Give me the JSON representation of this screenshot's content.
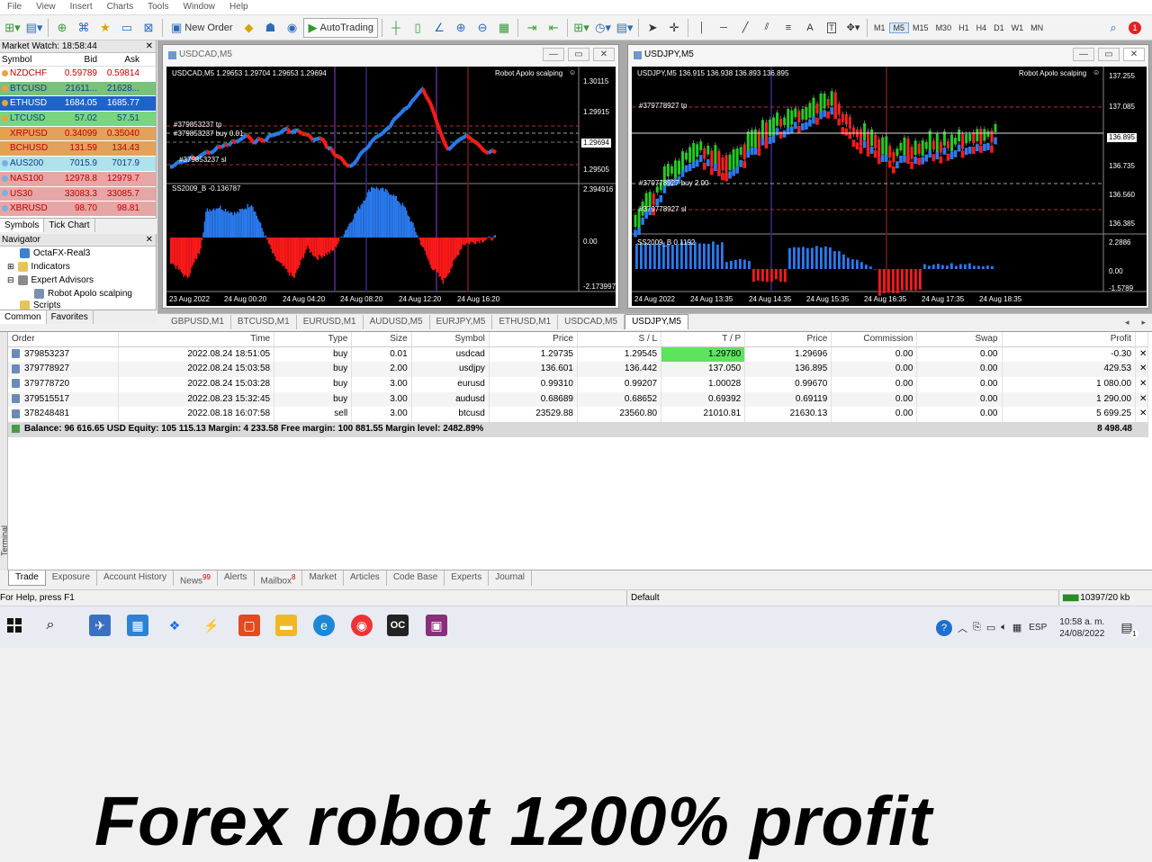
{
  "menubar": {
    "items": [
      "File",
      "View",
      "Insert",
      "Charts",
      "Tools",
      "Window",
      "Help"
    ]
  },
  "toolbar": {
    "new_order": "New Order",
    "autotrading": "AutoTrading",
    "timeframes": [
      "M1",
      "M5",
      "M15",
      "M30",
      "H1",
      "H4",
      "D1",
      "W1",
      "MN"
    ],
    "active_timeframe": "M5",
    "text_tool": "A",
    "label_tool": "T",
    "notification_count": "1"
  },
  "market_watch": {
    "title": "Market Watch: 18:58:44",
    "headers": [
      "Symbol",
      "Bid",
      "Ask"
    ],
    "rows": [
      {
        "symbol": "NZDCHF",
        "bid": "0.59789",
        "ask": "0.59814",
        "bg": "#ffffff",
        "fg": "#c00000",
        "dot": "#e8a33d"
      },
      {
        "symbol": "BTCUSD",
        "bid": "21611...",
        "ask": "21628...",
        "bg": "#79c279",
        "fg": "#0b3f8a",
        "dot": "#e8a33d"
      },
      {
        "symbol": "ETHUSD",
        "bid": "1684.05",
        "ask": "1685.77",
        "bg": "#1e64c8",
        "fg": "#ffffff",
        "dot": "#e8a33d"
      },
      {
        "symbol": "LTCUSD",
        "bid": "57.02",
        "ask": "57.51",
        "bg": "#78d67e",
        "fg": "#0b3f8a",
        "dot": "#e8a33d"
      },
      {
        "symbol": "XRPUSD",
        "bid": "0.34099",
        "ask": "0.35040",
        "bg": "#e2a25b",
        "fg": "#c00000",
        "dot": "#e8a33d"
      },
      {
        "symbol": "BCHUSD",
        "bid": "131.59",
        "ask": "134.43",
        "bg": "#e2a25b",
        "fg": "#c00000",
        "dot": "#e8a33d"
      },
      {
        "symbol": "AUS200",
        "bid": "7015.9",
        "ask": "7017.9",
        "bg": "#aee3ec",
        "fg": "#0b3f8a",
        "dot": "#7ab0e0"
      },
      {
        "symbol": "NAS100",
        "bid": "12978.8",
        "ask": "12979.7",
        "bg": "#e7a6a6",
        "fg": "#c00000",
        "dot": "#7ab0e0"
      },
      {
        "symbol": "US30",
        "bid": "33083.3",
        "ask": "33085.7",
        "bg": "#e7a6a6",
        "fg": "#c00000",
        "dot": "#7ab0e0"
      },
      {
        "symbol": "XBRUSD",
        "bid": "98.70",
        "ask": "98.81",
        "bg": "#e7a6a6",
        "fg": "#c00000",
        "dot": "#7ab0e0"
      }
    ],
    "tabs": [
      "Symbols",
      "Tick Chart"
    ]
  },
  "navigator": {
    "title": "Navigator",
    "items": [
      "OctaFX-Real3",
      "Indicators",
      "Expert Advisors",
      "Robot Apolo scalping",
      "Scripts"
    ],
    "tabs": [
      "Common",
      "Favorites"
    ]
  },
  "chart_usdcad": {
    "window_title": "USDCAD,M5",
    "header": "USDCAD,M5  1.29653 1.29704 1.29653 1.29694",
    "robot": "Robot Apolo scalping",
    "price_ticks": [
      "1.30115",
      "1.29915",
      "1.29694",
      "1.29505"
    ],
    "current_price": "1.29694",
    "order_labels": [
      "#379853237 tp",
      "#379853237 buy 0.01",
      "#379853237 sl"
    ],
    "indicator_label": "SS2009_B -0.136787",
    "indicator_ticks": [
      "2.394916",
      "0.00",
      "-2.173997"
    ],
    "time_ticks": [
      "23 Aug 2022",
      "24 Aug 00:20",
      "24 Aug 04:20",
      "24 Aug 08:20",
      "24 Aug 12:20",
      "24 Aug 16:20"
    ]
  },
  "chart_usdjpy": {
    "window_title": "USDJPY,M5",
    "header": "USDJPY,M5  136.915 136.938 136.893 136.895",
    "robot": "Robot Apolo scalping",
    "price_ticks": [
      "137.255",
      "137.085",
      "136.895",
      "136.735",
      "136.560",
      "136.385"
    ],
    "current_price": "136.895",
    "order_labels": [
      "#379778927 tp",
      "#379778927 buy 2.00",
      "#379778927 sl"
    ],
    "indicator_label": "SS2009_B 0.1192",
    "indicator_ticks": [
      "2.2886",
      "0.00",
      "-1.5789"
    ],
    "time_ticks": [
      "24 Aug 2022",
      "24 Aug 13:35",
      "24 Aug 14:35",
      "24 Aug 15:35",
      "24 Aug 16:35",
      "24 Aug 17:35",
      "24 Aug 18:35"
    ]
  },
  "chart_tabs": {
    "items": [
      "GBPUSD,M1",
      "BTCUSD,M1",
      "EURUSD,M1",
      "AUDUSD,M5",
      "EURJPY,M5",
      "ETHUSD,M1",
      "USDCAD,M5",
      "USDJPY,M5"
    ],
    "active": "USDJPY,M5"
  },
  "terminal": {
    "side_label": "Terminal",
    "headers": [
      "Order",
      "Time",
      "Type",
      "Size",
      "Symbol",
      "Price",
      "S / L",
      "T / P",
      "Price",
      "Commission",
      "Swap",
      "Profit"
    ],
    "rows": [
      {
        "order": "379853237",
        "time": "2022.08.24 18:51:05",
        "type": "buy",
        "size": "0.01",
        "symbol": "usdcad",
        "price": "1.29735",
        "sl": "1.29545",
        "tp": "1.29780",
        "cur": "1.29696",
        "commission": "0.00",
        "swap": "0.00",
        "profit": "-0.30",
        "tp_highlight": true
      },
      {
        "order": "379778927",
        "time": "2022.08.24 15:03:58",
        "type": "buy",
        "size": "2.00",
        "symbol": "usdjpy",
        "price": "136.601",
        "sl": "136.442",
        "tp": "137.050",
        "cur": "136.895",
        "commission": "0.00",
        "swap": "0.00",
        "profit": "429.53",
        "tp_highlight": false
      },
      {
        "order": "379778720",
        "time": "2022.08.24 15:03:28",
        "type": "buy",
        "size": "3.00",
        "symbol": "eurusd",
        "price": "0.99310",
        "sl": "0.99207",
        "tp": "1.00028",
        "cur": "0.99670",
        "commission": "0.00",
        "swap": "0.00",
        "profit": "1 080.00",
        "tp_highlight": false
      },
      {
        "order": "379515517",
        "time": "2022.08.23 15:32:45",
        "type": "buy",
        "size": "3.00",
        "symbol": "audusd",
        "price": "0.68689",
        "sl": "0.68652",
        "tp": "0.69392",
        "cur": "0.69119",
        "commission": "0.00",
        "swap": "0.00",
        "profit": "1 290.00",
        "tp_highlight": false
      },
      {
        "order": "378248481",
        "time": "2022.08.18 16:07:58",
        "type": "sell",
        "size": "3.00",
        "symbol": "btcusd",
        "price": "23529.88",
        "sl": "23560.80",
        "tp": "21010.81",
        "cur": "21630.13",
        "commission": "0.00",
        "swap": "0.00",
        "profit": "5 699.25",
        "tp_highlight": false
      }
    ],
    "balance_line": "Balance: 96 616.65 USD  Equity: 105 115.13  Margin: 4 233.58  Free margin: 100 881.55  Margin level: 2482.89%",
    "total_profit": "8 498.48",
    "tabs": [
      "Trade",
      "Exposure",
      "Account History",
      "News",
      "Alerts",
      "Mailbox",
      "Market",
      "Articles",
      "Code Base",
      "Experts",
      "Journal"
    ],
    "news_badge": "99",
    "mailbox_badge": "8"
  },
  "overlay_text": "Forex robot 1200% profit",
  "status": {
    "help": "For Help, press F1",
    "profile": "Default",
    "traffic": "10397/20 kb"
  },
  "taskbar": {
    "lang": "ESP",
    "time": "10:58 a. m.",
    "date": "24/08/2022",
    "notif": "1"
  },
  "colors": {
    "bull": "#2a7bf0",
    "bear": "#ff1a1a",
    "candle_up": "#22cc22",
    "candle_down": "#ff2222",
    "tp_cell": "#5ee35e"
  }
}
